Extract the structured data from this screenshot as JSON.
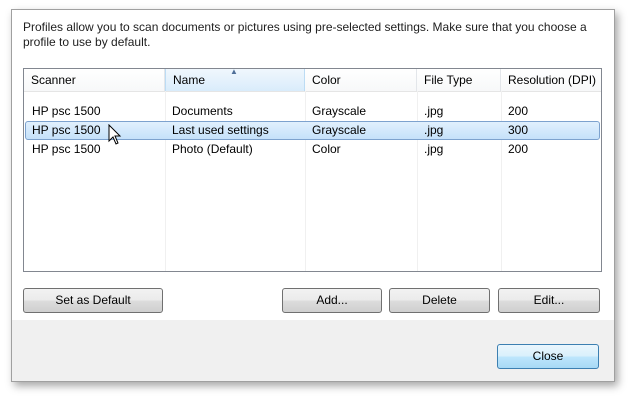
{
  "dialog": {
    "description": "Profiles allow you to scan documents or pictures using pre-selected settings. Make sure that you choose a profile to use by default."
  },
  "profiles_table": {
    "columns": [
      "Scanner",
      "Name",
      "Color",
      "File Type",
      "Resolution (DPI)"
    ],
    "sorted_column": "Name",
    "rows": [
      {
        "scanner": "HP psc 1500",
        "name": "Documents",
        "color": "Grayscale",
        "file_type": ".jpg",
        "resolution": "200"
      },
      {
        "scanner": "HP psc 1500",
        "name": "Last used settings",
        "color": "Grayscale",
        "file_type": ".jpg",
        "resolution": "300"
      },
      {
        "scanner": "HP psc 1500",
        "name": "Photo (Default)",
        "color": "Color",
        "file_type": ".jpg",
        "resolution": "200"
      }
    ],
    "selected_row": 1
  },
  "buttons": {
    "set_default": "Set as Default",
    "add": "Add...",
    "delete": "Delete",
    "edit": "Edit...",
    "close": "Close"
  },
  "icons": {
    "sort": "sort-ascending-icon",
    "cursor": "mouse-pointer-icon"
  }
}
